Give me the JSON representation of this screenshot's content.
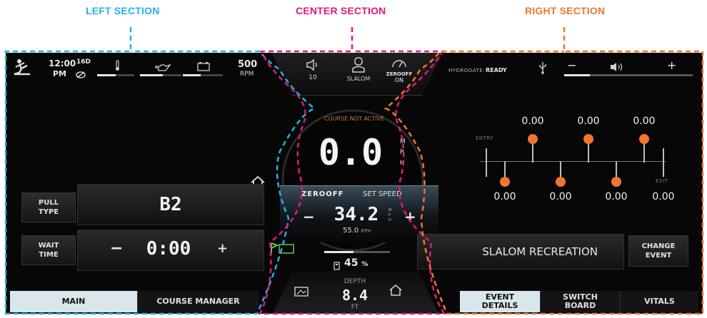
{
  "sections": {
    "left": "LEFT SECTION",
    "center": "CENTER SECTION",
    "right": "RIGHT SECTION"
  },
  "colors": {
    "left": "#1fb5e6",
    "center": "#e0197d",
    "right": "#f0762f",
    "accent": "#f0762f"
  },
  "status_bar": {
    "time": "12:00",
    "ampm": "PM",
    "heading": "16D",
    "rpm_value": "500",
    "rpm_unit": "RPM",
    "temp_level": 0.5,
    "oil_level": 0.55,
    "battery_level": 0.45
  },
  "top_center": {
    "volume_label": "10",
    "profile_label": "SLALOM",
    "zero_off_brand": "ZEROOFF",
    "zero_off_state": "ON"
  },
  "top_right": {
    "hydrogate_label": "HYDROGATE:",
    "hydrogate_status": "READY",
    "minus": "−",
    "plus": "+",
    "volume_level": 0.2
  },
  "speed": {
    "course_status": "COURSE NOT ACTIVE",
    "value": "0.0",
    "unit": "MPH",
    "zero_off_brand": "ZEROOFF",
    "set_speed_label": "SET SPEED",
    "set_speed": "34.2",
    "set_speed_unit": "MPH",
    "kph": "55.0",
    "kph_unit": "KPH",
    "minus": "−",
    "plus": "+"
  },
  "left_controls": {
    "pull_type_label": "PULL\nTYPE",
    "pull_type_value": "B2",
    "wait_time_label": "WAIT\nTIME",
    "wait_time_value": "0:00",
    "minus": "−",
    "plus": "+"
  },
  "fuel": {
    "level_label": "45",
    "level_unit": "%",
    "fraction": 0.45
  },
  "depth": {
    "label": "DEPTH",
    "value": "8.4",
    "unit": "FT"
  },
  "event": {
    "entry_label": "ENTRY",
    "exit_label": "EXIT",
    "top_values": [
      "0.00",
      "0.00",
      "0.00"
    ],
    "bottom_values": [
      "0.00",
      "0.00",
      "0.00",
      "0.00"
    ],
    "event_name": "SLALOM RECREATION",
    "change_label": "CHANGE\nEVENT"
  },
  "tabs_left": [
    {
      "label": "MAIN"
    },
    {
      "label": "COURSE MANAGER"
    }
  ],
  "tabs_right": [
    {
      "label": "EVENT\nDETAILS"
    },
    {
      "label": "SWITCH\nBOARD"
    },
    {
      "label": "VITALS"
    }
  ]
}
